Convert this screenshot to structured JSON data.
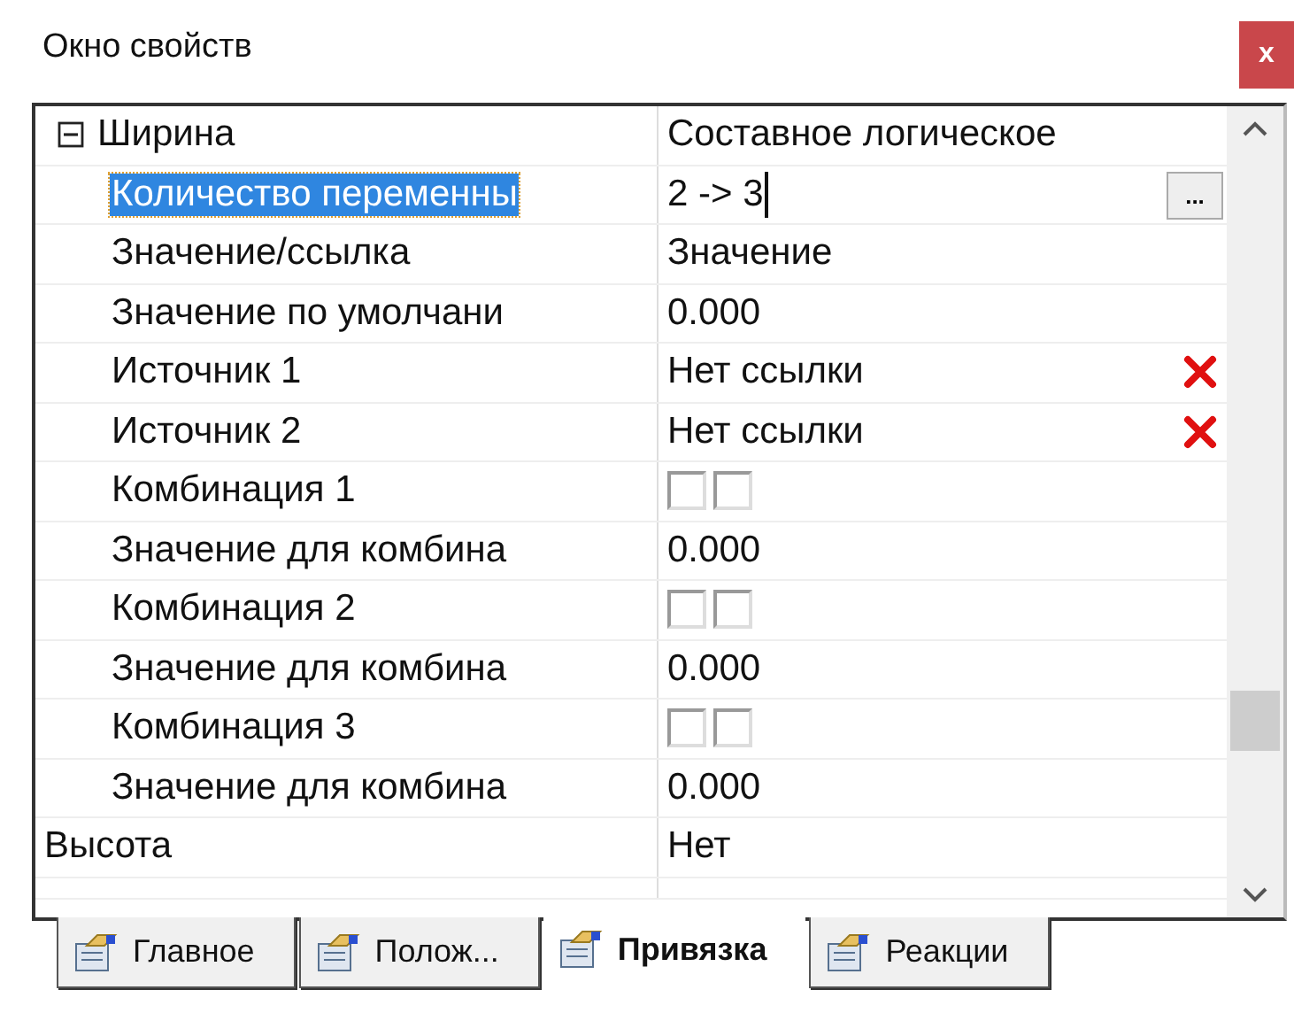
{
  "window": {
    "title": "Окно свойств",
    "close": "x"
  },
  "properties": [
    {
      "kind": "group",
      "name": "Ширина",
      "value": "Составное логическое",
      "expanded": true,
      "children": [
        {
          "kind": "edit",
          "name": "Количество переменны",
          "value": "2 -> 3",
          "selected": true,
          "button": "..."
        },
        {
          "kind": "text",
          "name": "Значение/ссылка",
          "value": "Значение",
          "selected": false
        },
        {
          "kind": "text",
          "name": "Значение по умолчани",
          "value": "0.000",
          "selected": false
        },
        {
          "kind": "link",
          "name": "Источник 1",
          "value": "Нет ссылки",
          "selected": false
        },
        {
          "kind": "link",
          "name": "Источник 2",
          "value": "Нет ссылки",
          "selected": false
        },
        {
          "kind": "checks",
          "name": "Комбинация 1",
          "checks": [
            false,
            false
          ],
          "selected": false
        },
        {
          "kind": "text",
          "name": "Значение для комбина",
          "value": "0.000",
          "selected": false
        },
        {
          "kind": "checks",
          "name": "Комбинация 2",
          "checks": [
            false,
            false
          ],
          "selected": false
        },
        {
          "kind": "text",
          "name": "Значение для комбина",
          "value": "0.000",
          "selected": false
        },
        {
          "kind": "checks",
          "name": "Комбинация 3",
          "checks": [
            false,
            false
          ],
          "selected": false
        },
        {
          "kind": "text",
          "name": "Значение для комбина",
          "value": "0.000",
          "selected": false
        }
      ]
    },
    {
      "kind": "text",
      "name": "Высота",
      "value": "Нет",
      "selected": false
    }
  ],
  "tabs": [
    {
      "label": "Главное",
      "selected": false
    },
    {
      "label": "Полож...",
      "selected": false
    },
    {
      "label": "Привязка",
      "selected": true
    },
    {
      "label": "Реакции",
      "selected": false
    }
  ]
}
